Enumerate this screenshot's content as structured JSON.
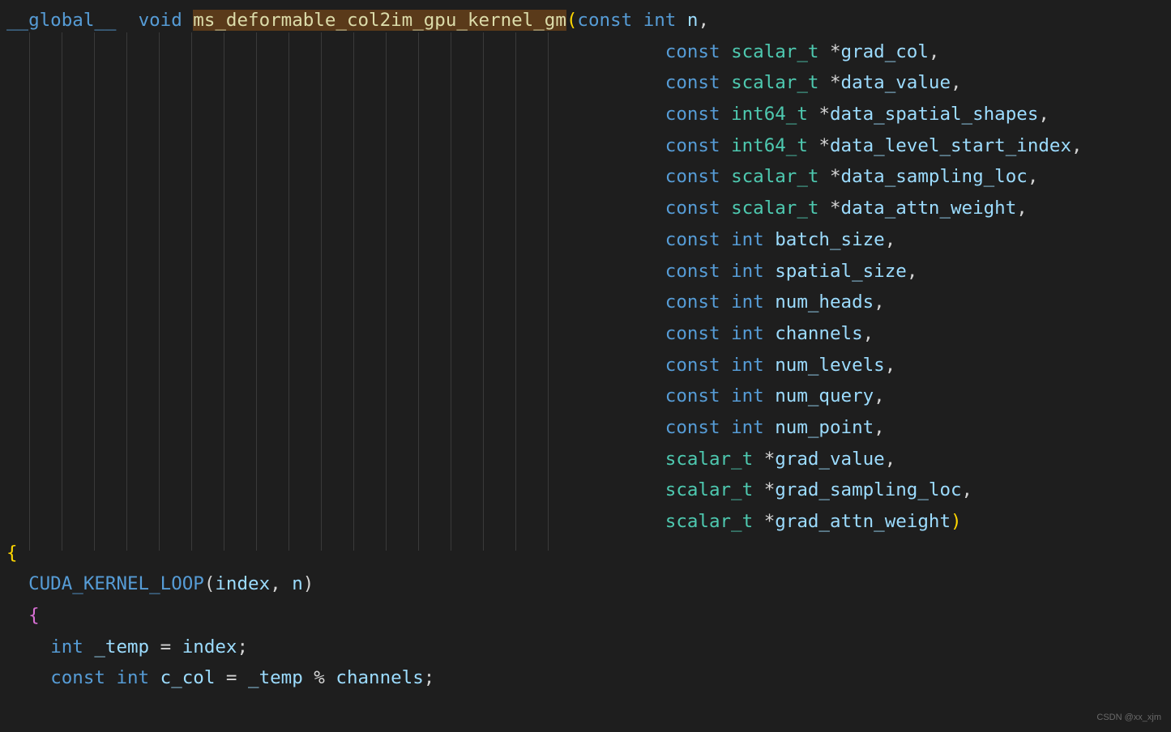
{
  "line1": {
    "global": "__global__",
    "void": "void",
    "fn": "ms_deformable_col2im_gpu_kernel_gm",
    "paren": "(",
    "const": "const",
    "int": "int",
    "n": "n",
    "comma": ","
  },
  "params": [
    {
      "const": "const",
      "type": "scalar_t",
      "star": "*",
      "name": "grad_col",
      "comma": ","
    },
    {
      "const": "const",
      "type": "scalar_t",
      "star": "*",
      "name": "data_value",
      "comma": ","
    },
    {
      "const": "const",
      "type": "int64_t",
      "star": "*",
      "name": "data_spatial_shapes",
      "comma": ","
    },
    {
      "const": "const",
      "type": "int64_t",
      "star": "*",
      "name": "data_level_start_index",
      "comma": ","
    },
    {
      "const": "const",
      "type": "scalar_t",
      "star": "*",
      "name": "data_sampling_loc",
      "comma": ","
    },
    {
      "const": "const",
      "type": "scalar_t",
      "star": "*",
      "name": "data_attn_weight",
      "comma": ","
    },
    {
      "const": "const",
      "type": "int",
      "star": "",
      "name": "batch_size",
      "comma": ","
    },
    {
      "const": "const",
      "type": "int",
      "star": "",
      "name": "spatial_size",
      "comma": ","
    },
    {
      "const": "const",
      "type": "int",
      "star": "",
      "name": "num_heads",
      "comma": ","
    },
    {
      "const": "const",
      "type": "int",
      "star": "",
      "name": "channels",
      "comma": ","
    },
    {
      "const": "const",
      "type": "int",
      "star": "",
      "name": "num_levels",
      "comma": ","
    },
    {
      "const": "const",
      "type": "int",
      "star": "",
      "name": "num_query",
      "comma": ","
    },
    {
      "const": "const",
      "type": "int",
      "star": "",
      "name": "num_point",
      "comma": ","
    },
    {
      "const": "",
      "type": "scalar_t",
      "star": "*",
      "name": "grad_value",
      "comma": ","
    },
    {
      "const": "",
      "type": "scalar_t",
      "star": "*",
      "name": "grad_sampling_loc",
      "comma": ","
    },
    {
      "const": "",
      "type": "scalar_t",
      "star": "*",
      "name": "grad_attn_weight",
      "comma": ""
    }
  ],
  "close_paren": ")",
  "brace_open": "{",
  "loop": {
    "macro": "CUDA_KERNEL_LOOP",
    "lp": "(",
    "arg1": "index",
    "comma": ", ",
    "arg2": "n",
    "rp": ")"
  },
  "inner_brace": "{",
  "stmt1": {
    "int": "int",
    "name": "_temp",
    "eq": " = ",
    "rhs": "index",
    "semi": ";"
  },
  "stmt2": {
    "const": "const",
    "int": "int",
    "name": "c_col",
    "eq": " = ",
    "rhs1": "_temp",
    "op": " % ",
    "rhs2": "channels",
    "semi": ";"
  },
  "watermark": "CSDN @xx_xjm",
  "param_indent": "                                                            "
}
